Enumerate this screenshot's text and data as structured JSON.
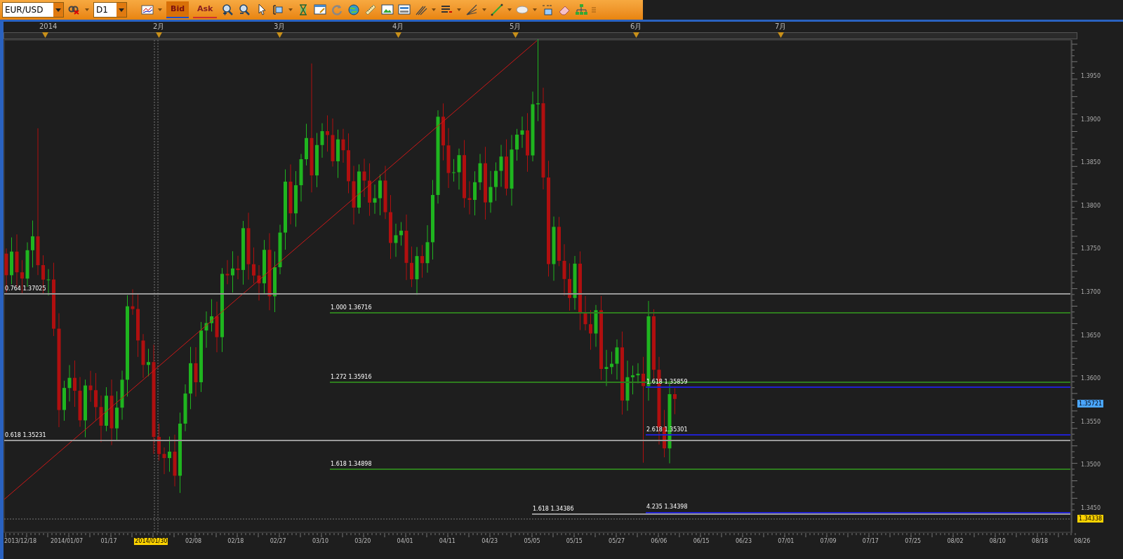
{
  "toolbar": {
    "symbol": "EUR/USD",
    "timeframe": "D1",
    "price_buttons": [
      {
        "label": "Bid",
        "selected": true
      },
      {
        "label": "Ask",
        "selected": false
      }
    ]
  },
  "chart": {
    "period_markers": [
      "2014",
      "2月",
      "3月",
      "4月",
      "5月",
      "6月",
      "7月"
    ],
    "price_ticks": [
      "1.3950",
      "1.3900",
      "1.3850",
      "1.3800",
      "1.3750",
      "1.3700",
      "1.3650",
      "1.3600",
      "1.3550",
      "1.3500",
      "1.3450"
    ],
    "current_price": "1.35721",
    "marker_price": "1.34338",
    "dates": [
      {
        "label": "2013/12/18",
        "selected": false
      },
      {
        "label": "2014/01/07",
        "selected": false
      },
      {
        "label": "01/17",
        "selected": false
      },
      {
        "label": "2014/01/30",
        "selected": true
      },
      {
        "label": "02/08",
        "selected": false
      },
      {
        "label": "02/18",
        "selected": false
      },
      {
        "label": "02/27",
        "selected": false
      },
      {
        "label": "03/10",
        "selected": false
      },
      {
        "label": "03/20",
        "selected": false
      },
      {
        "label": "04/01",
        "selected": false
      },
      {
        "label": "04/11",
        "selected": false
      },
      {
        "label": "04/23",
        "selected": false
      },
      {
        "label": "05/05",
        "selected": false
      },
      {
        "label": "05/15",
        "selected": false
      },
      {
        "label": "05/27",
        "selected": false
      },
      {
        "label": "06/06",
        "selected": false
      },
      {
        "label": "06/15",
        "selected": false
      },
      {
        "label": "06/23",
        "selected": false
      },
      {
        "label": "07/01",
        "selected": false
      },
      {
        "label": "07/09",
        "selected": false
      },
      {
        "label": "07/17",
        "selected": false
      },
      {
        "label": "07/25",
        "selected": false
      },
      {
        "label": "08/02",
        "selected": false
      },
      {
        "label": "08/10",
        "selected": false
      },
      {
        "label": "08/18",
        "selected": false
      },
      {
        "label": "08/26",
        "selected": false
      }
    ],
    "fib_levels": [
      {
        "label": "0.764 1.37025",
        "color": "#9a9a9a"
      },
      {
        "label": "1.000 1.36716",
        "color": "#2e7d1e"
      },
      {
        "label": "1.272 1.35916",
        "color": "#2e7d1e"
      },
      {
        "label": "1.618 1.35859",
        "color": "#2020d0"
      },
      {
        "label": "2.618 1.35301",
        "color": "#2020d0"
      },
      {
        "label": "0.618 1.35231",
        "color": "#9a9a9a"
      },
      {
        "label": "1.618 1.34898",
        "color": "#2e7d1e"
      },
      {
        "label": "1.618 1.34386",
        "color": "#9a9a9a"
      },
      {
        "label": "4.235 1.34398",
        "color": "#2020d0"
      }
    ]
  }
}
